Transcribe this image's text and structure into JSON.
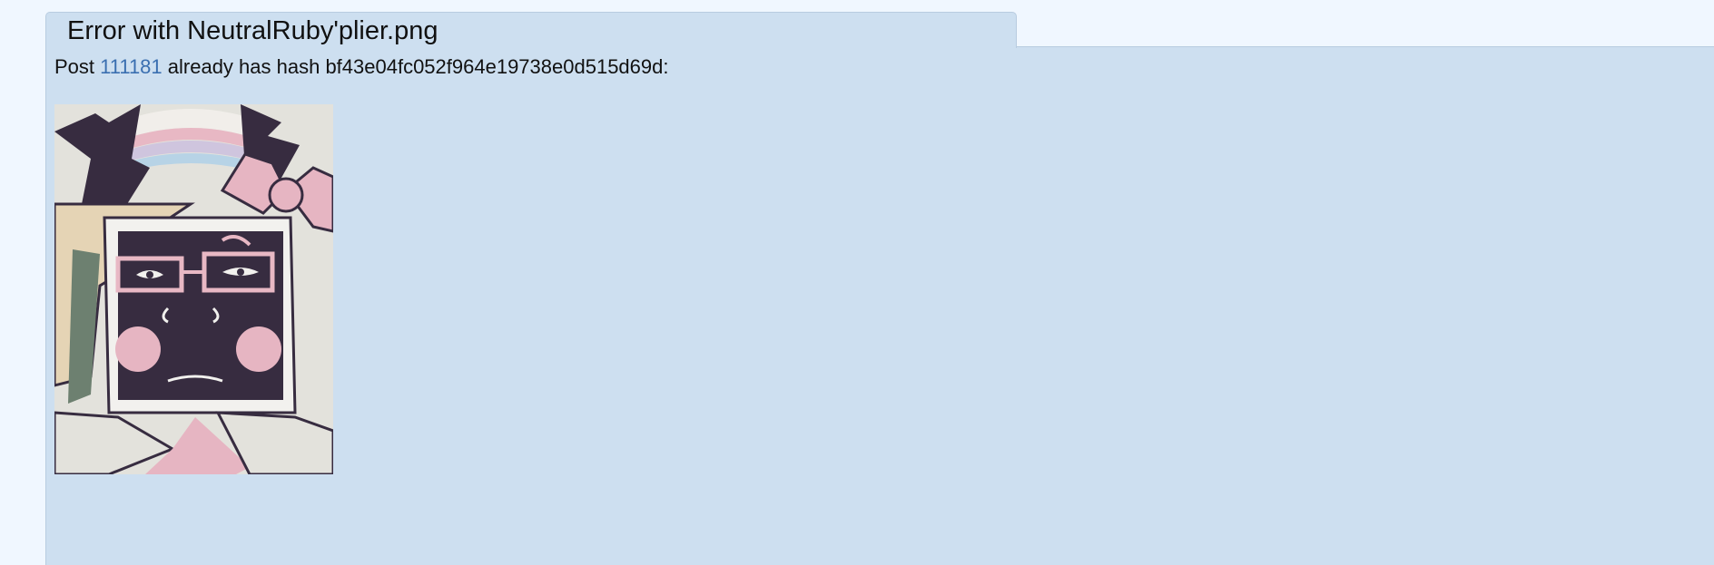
{
  "title": {
    "prefix": "Error with ",
    "filename": "NeutralRuby'plier.png"
  },
  "message": {
    "prefix": "Post ",
    "post_id": "111181",
    "suffix": " already has hash bf43e04fc052f964e19738e0d515d69d:"
  },
  "thumbnail": {
    "alt": "thumbnail of existing post",
    "icon": "tv-head-character-image"
  },
  "colors": {
    "page_bg": "#f0f7ff",
    "panel_bg": "#cddff0",
    "link": "#3a6fb0"
  }
}
